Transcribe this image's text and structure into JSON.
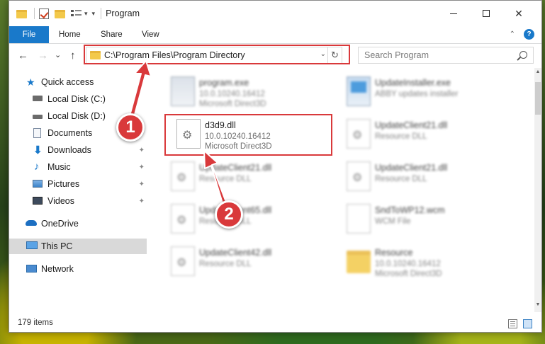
{
  "window": {
    "title": "Program",
    "controls": {
      "minimize": "—",
      "maximize": "",
      "close": "✕"
    }
  },
  "ribbon": {
    "file_tab": "File",
    "tabs": [
      "Home",
      "Share",
      "View"
    ],
    "collapse": "⌃",
    "help": "?"
  },
  "nav": {
    "back": "←",
    "forward": "→",
    "recent": "⌄",
    "up": "↑"
  },
  "address": {
    "path": "C:\\Program Files\\Program Directory",
    "dropdown": "⌄",
    "refresh": "↻"
  },
  "search": {
    "placeholder": "Search Program"
  },
  "sidebar": {
    "items": [
      {
        "label": "Quick access",
        "icon": "star-icon"
      },
      {
        "label": "Local Disk (C:)",
        "icon": "drive-icon",
        "pinned": true
      },
      {
        "label": "Local Disk (D:)",
        "icon": "drive-icon",
        "pinned": true
      },
      {
        "label": "Documents",
        "icon": "documents-icon",
        "pinned": true
      },
      {
        "label": "Downloads",
        "icon": "downloads-icon",
        "pinned": true
      },
      {
        "label": "Music",
        "icon": "music-icon",
        "pinned": true
      },
      {
        "label": "Pictures",
        "icon": "pictures-icon",
        "pinned": true
      },
      {
        "label": "Videos",
        "icon": "videos-icon",
        "pinned": true
      },
      {
        "label": "OneDrive",
        "icon": "onedrive-icon"
      },
      {
        "label": "This PC",
        "icon": "computer-icon",
        "selected": true
      },
      {
        "label": "Network",
        "icon": "network-icon"
      }
    ],
    "pin_glyph": "📌"
  },
  "files": [
    {
      "name": "program.exe",
      "line1": "10.0.10240.16412",
      "line2": "Microsoft Direct3D",
      "icon": "exe-icon"
    },
    {
      "name": "UpdateInstaller.exe",
      "line1": "ABBY updates installer",
      "line2": "",
      "icon": "installer-icon"
    },
    {
      "name": "d3d9.dll",
      "line1": "10.0.10240.16412",
      "line2": "Microsoft Direct3D",
      "icon": "dll-icon",
      "highlighted": true
    },
    {
      "name": "UpdateClient21.dll",
      "line1": "Resource DLL",
      "line2": "",
      "icon": "dll-icon"
    },
    {
      "name": "UpdateClient21.dll",
      "line1": "Resource DLL",
      "line2": "",
      "icon": "dll-icon"
    },
    {
      "name": "UpdateClient21.dll",
      "line1": "Resource DLL",
      "line2": "",
      "icon": "dll-icon"
    },
    {
      "name": "UpdateClient65.dll",
      "line1": "Resource DLL",
      "line2": "",
      "icon": "dll-icon"
    },
    {
      "name": "SndToWP12.wcm",
      "line1": "WCM File",
      "line2": "",
      "icon": "file-icon"
    },
    {
      "name": "UpdateClient42.dll",
      "line1": "Resource DLL",
      "line2": "",
      "icon": "dll-icon"
    },
    {
      "name": "Resource",
      "line1": "10.0.10240.16412",
      "line2": "Microsoft Direct3D",
      "icon": "folder-icon"
    }
  ],
  "status": {
    "item_count": "179 items"
  },
  "annotations": {
    "step1": "1",
    "step2": "2",
    "highlight_color": "#d9393b"
  },
  "colors": {
    "accent": "#1979ca",
    "folder": "#f3c94a",
    "selection": "#d9d9d9"
  }
}
